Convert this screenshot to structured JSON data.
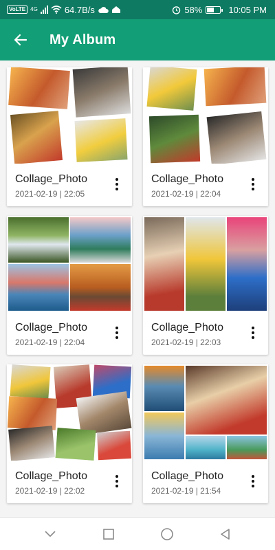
{
  "status_bar": {
    "volte": "VoLTE",
    "network": "4G",
    "speed": "64.7B/s",
    "battery_percent": "58%",
    "battery_level": 0.58,
    "time": "10:05 PM",
    "icons": [
      "signal-icon",
      "wifi-icon",
      "cloud-icon",
      "notification-icon",
      "alarm-icon",
      "battery-icon"
    ]
  },
  "app_bar": {
    "title": "My Album",
    "back_icon": "arrow-left-icon",
    "color": "#129e76"
  },
  "albums": [
    {
      "name": "Collage_Photo",
      "date": "2021-02-19 | 22:05"
    },
    {
      "name": "Collage_Photo",
      "date": "2021-02-19 | 22:04"
    },
    {
      "name": "Collage_Photo",
      "date": "2021-02-19 | 22:04"
    },
    {
      "name": "Collage_Photo",
      "date": "2021-02-19 | 22:03"
    },
    {
      "name": "Collage_Photo",
      "date": "2021-02-19 | 22:02"
    },
    {
      "name": "Collage_Photo",
      "date": "2021-02-19 | 21:54"
    }
  ],
  "nav_bar": {
    "icons": [
      "chevron-down-icon",
      "square-recents-icon",
      "circle-home-icon",
      "triangle-back-icon"
    ]
  }
}
